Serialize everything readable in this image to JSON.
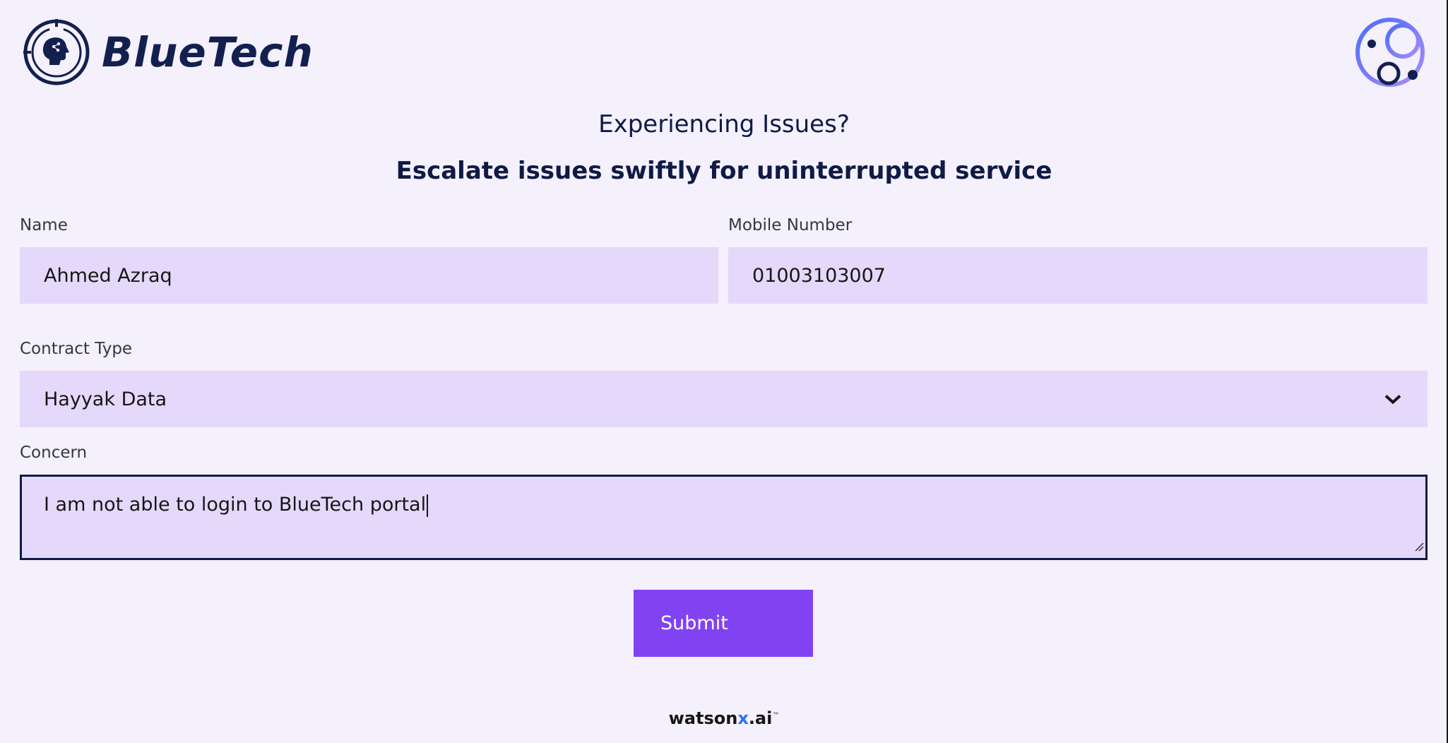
{
  "brand": {
    "name": "BlueTech",
    "logo_icon": "ai-head-icon",
    "corner_icon": "watsonx-orchestrate-icon"
  },
  "heading": {
    "title": "Experiencing Issues?",
    "subtitle": "Escalate issues swiftly for uninterrupted service"
  },
  "form": {
    "name": {
      "label": "Name",
      "value": "Ahmed Azraq"
    },
    "mobile": {
      "label": "Mobile Number",
      "value": "01003103007"
    },
    "contract": {
      "label": "Contract Type",
      "selected": "Hayyak Data"
    },
    "concern": {
      "label": "Concern",
      "value": "I am not able to login to BlueTech portal"
    },
    "submit_label": "Submit"
  },
  "footer": {
    "prefix": "watson",
    "x": "x",
    "suffix": ".ai",
    "trademark": "™"
  },
  "colors": {
    "background": "#f4f0fc",
    "field": "#e4d9fa",
    "accent": "#8142f2",
    "text_dark": "#0f1b45"
  }
}
